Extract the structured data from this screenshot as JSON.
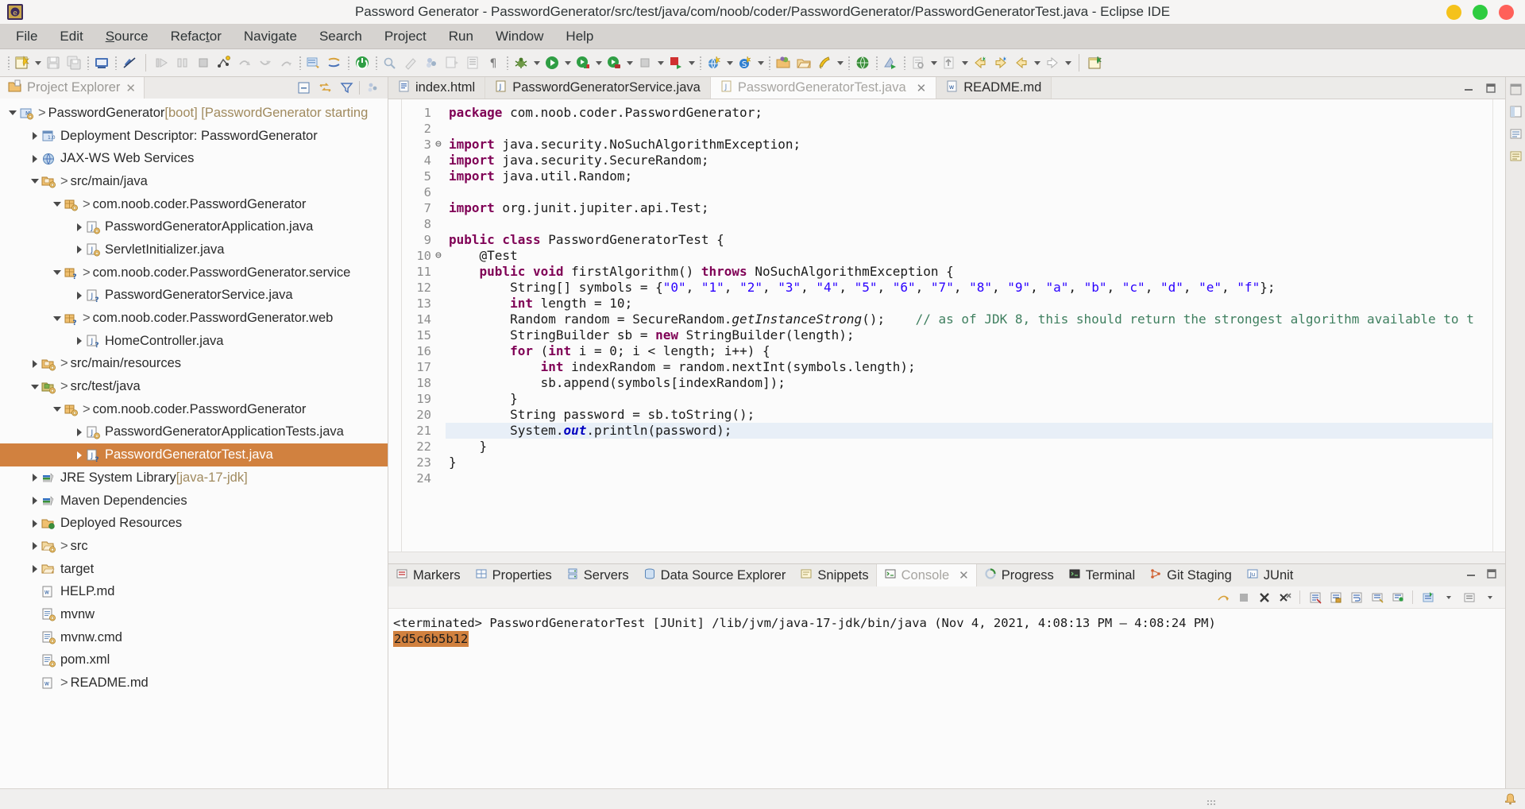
{
  "window": {
    "title": "Password Generator - PasswordGenerator/src/test/java/com/noob/coder/PasswordGenerator/PasswordGeneratorTest.java - Eclipse IDE",
    "logo_icon": "eclipse-logo-icon",
    "controls": [
      {
        "name": "minimize-button",
        "color": "#f5c21b"
      },
      {
        "name": "maximize-button",
        "color": "#2ecc40"
      },
      {
        "name": "close-button",
        "color": "#ff6059"
      }
    ]
  },
  "menubar": {
    "items": [
      {
        "label": "File",
        "mnemonic": "F"
      },
      {
        "label": "Edit",
        "mnemonic": "E"
      },
      {
        "label": "Source",
        "mnemonic": "S"
      },
      {
        "label": "Refactor",
        "mnemonic": "t"
      },
      {
        "label": "Navigate",
        "mnemonic": "N"
      },
      {
        "label": "Search",
        "mnemonic": "a"
      },
      {
        "label": "Project",
        "mnemonic": "P"
      },
      {
        "label": "Run",
        "mnemonic": "R"
      },
      {
        "label": "Window",
        "mnemonic": "W"
      },
      {
        "label": "Help",
        "mnemonic": "H"
      }
    ]
  },
  "toolbar": {
    "icons": [
      "new-wizard-icon",
      "new-dropdown-arrow",
      "save-icon",
      "save-all-icon",
      "print-icon",
      "link-broken-icon",
      "debug-run-icon",
      "pause-icon",
      "terminate-icon",
      "step-into-icon",
      "step-over-icon",
      "step-return-icon",
      "drop-to-frame-icon",
      "open-task-icon",
      "skip-breakpoints-icon",
      "power-run-server-icon",
      "new-java-project-icon",
      "new-annotation-icon",
      "new-package-icon",
      "export-icon",
      "open-type-icon",
      "show-whitespace-icon",
      "debug-bug-icon",
      "debug-dropdown-arrow",
      "run-icon",
      "run-dropdown-arrow",
      "run-coverage-icon",
      "coverage-dropdown-arrow",
      "external-tools-icon",
      "external-dropdown-arrow",
      "server-stop-icon",
      "server-stop-arrow",
      "server-start-icon",
      "server-start-arrow",
      "new-web-project-icon",
      "web-dropdown-arrow",
      "spring-boot-icon",
      "spring-dropdown-arrow",
      "open-package-icon",
      "open-folder-icon",
      "quick-launch-icon",
      "launch-dropdown-arrow",
      "web-browser-icon",
      "validate-icon",
      "search-file-icon",
      "search-dropdown-arrow",
      "annotation-prev-icon",
      "annotation-dropdown-arrow",
      "back-history-icon",
      "forward-history-icon",
      "previous-edit-icon",
      "previous-dropdown-arrow",
      "next-edit-icon",
      "next-dropdown-arrow",
      "new-editor-icon"
    ]
  },
  "explorer": {
    "tab_label": "Project Explorer",
    "tab_icon": "project-explorer-icon",
    "tab_close_icon": "close-icon",
    "tools": [
      "collapse-all-icon",
      "link-with-editor-icon",
      "view-filter-icon",
      "view-menu-icon"
    ],
    "tree": [
      {
        "indent": 0,
        "twisty": "open",
        "icon": "spring-project-icon",
        "gt": true,
        "label": "PasswordGenerator",
        "dim": " [boot] [PasswordGenerator starting"
      },
      {
        "indent": 1,
        "twisty": "closed",
        "icon": "deployment-descriptor-icon",
        "gt": false,
        "label": "Deployment Descriptor: PasswordGenerator",
        "dim": ""
      },
      {
        "indent": 1,
        "twisty": "closed",
        "icon": "jaxws-icon",
        "gt": false,
        "label": "JAX-WS Web Services",
        "dim": ""
      },
      {
        "indent": 1,
        "twisty": "open",
        "icon": "source-folder-icon",
        "gt": true,
        "label": "src/main/java",
        "dim": ""
      },
      {
        "indent": 2,
        "twisty": "open",
        "icon": "package-icon",
        "gt": true,
        "label": "com.noob.coder.PasswordGenerator",
        "dim": ""
      },
      {
        "indent": 3,
        "twisty": "closed",
        "icon": "java-file-icon",
        "gt": false,
        "label": "PasswordGeneratorApplication.java",
        "dim": ""
      },
      {
        "indent": 3,
        "twisty": "closed",
        "icon": "java-file-icon",
        "gt": false,
        "label": "ServletInitializer.java",
        "dim": ""
      },
      {
        "indent": 2,
        "twisty": "open",
        "icon": "package-untracked-icon",
        "gt": true,
        "label": "com.noob.coder.PasswordGenerator.service",
        "dim": ""
      },
      {
        "indent": 3,
        "twisty": "closed",
        "icon": "java-file-untracked-icon",
        "gt": false,
        "label": "PasswordGeneratorService.java",
        "dim": ""
      },
      {
        "indent": 2,
        "twisty": "open",
        "icon": "package-untracked-icon",
        "gt": true,
        "label": "com.noob.coder.PasswordGenerator.web",
        "dim": ""
      },
      {
        "indent": 3,
        "twisty": "closed",
        "icon": "java-file-untracked-icon",
        "gt": false,
        "label": "HomeController.java",
        "dim": ""
      },
      {
        "indent": 1,
        "twisty": "closed",
        "icon": "source-folder-icon",
        "gt": true,
        "label": "src/main/resources",
        "dim": ""
      },
      {
        "indent": 1,
        "twisty": "open",
        "icon": "test-source-folder-icon",
        "gt": true,
        "label": "src/test/java",
        "dim": ""
      },
      {
        "indent": 2,
        "twisty": "open",
        "icon": "package-icon",
        "gt": true,
        "label": "com.noob.coder.PasswordGenerator",
        "dim": ""
      },
      {
        "indent": 3,
        "twisty": "closed",
        "icon": "java-file-icon",
        "gt": false,
        "label": "PasswordGeneratorApplicationTests.java",
        "dim": ""
      },
      {
        "indent": 3,
        "twisty": "closed",
        "icon": "java-file-untracked-icon",
        "gt": false,
        "label": "PasswordGeneratorTest.java",
        "dim": "",
        "selected": true
      },
      {
        "indent": 1,
        "twisty": "closed",
        "icon": "library-icon",
        "gt": false,
        "label": "JRE System Library ",
        "dim": "[java-17-jdk]"
      },
      {
        "indent": 1,
        "twisty": "closed",
        "icon": "library-icon",
        "gt": false,
        "label": "Maven Dependencies",
        "dim": ""
      },
      {
        "indent": 1,
        "twisty": "closed",
        "icon": "deployed-resources-icon",
        "gt": false,
        "label": "Deployed Resources",
        "dim": ""
      },
      {
        "indent": 1,
        "twisty": "closed",
        "icon": "folder-icon",
        "gt": true,
        "label": "src",
        "dim": ""
      },
      {
        "indent": 1,
        "twisty": "closed",
        "icon": "folder-plain-icon",
        "gt": false,
        "label": "target",
        "dim": ""
      },
      {
        "indent": 1,
        "twisty": "none",
        "icon": "markdown-file-icon",
        "gt": false,
        "label": "HELP.md",
        "dim": ""
      },
      {
        "indent": 1,
        "twisty": "none",
        "icon": "text-file-icon",
        "gt": false,
        "label": "mvnw",
        "dim": ""
      },
      {
        "indent": 1,
        "twisty": "none",
        "icon": "text-file-icon",
        "gt": false,
        "label": "mvnw.cmd",
        "dim": ""
      },
      {
        "indent": 1,
        "twisty": "none",
        "icon": "xml-file-icon",
        "gt": false,
        "label": "pom.xml",
        "dim": ""
      },
      {
        "indent": 1,
        "twisty": "none",
        "icon": "markdown-file-icon",
        "gt": true,
        "label": "README.md",
        "dim": ""
      }
    ]
  },
  "editor": {
    "tabs": [
      {
        "label": "index.html",
        "icon": "html-file-icon",
        "active": false,
        "closable": false
      },
      {
        "label": "PasswordGeneratorService.java",
        "icon": "java-file-icon",
        "active": false,
        "closable": false
      },
      {
        "label": "PasswordGeneratorTest.java",
        "icon": "java-file-icon",
        "active": true,
        "closable": true,
        "close_icon": "close-icon"
      },
      {
        "label": "README.md",
        "icon": "markdown-file-icon",
        "active": false,
        "closable": false
      }
    ],
    "minimize_icon": "minimize-icon",
    "maximize_icon": "maximize-icon",
    "highlighted_line": 21,
    "lines": [
      {
        "n": 1,
        "fold": "",
        "html": "<span class=\"kw\">package</span> com.noob.coder.PasswordGenerator;"
      },
      {
        "n": 2,
        "fold": "",
        "html": ""
      },
      {
        "n": 3,
        "fold": "⊖",
        "html": "<span class=\"kw\">import</span> java.security.NoSuchAlgorithmException;"
      },
      {
        "n": 4,
        "fold": "",
        "html": "<span class=\"kw\">import</span> java.security.SecureRandom;"
      },
      {
        "n": 5,
        "fold": "",
        "html": "<span class=\"kw\">import</span> java.util.Random;"
      },
      {
        "n": 6,
        "fold": "",
        "html": ""
      },
      {
        "n": 7,
        "fold": "",
        "html": "<span class=\"kw\">import</span> org.junit.jupiter.api.Test;"
      },
      {
        "n": 8,
        "fold": "",
        "html": ""
      },
      {
        "n": 9,
        "fold": "",
        "html": "<span class=\"kw\">public class</span> PasswordGeneratorTest {"
      },
      {
        "n": 10,
        "fold": "⊖",
        "html": "    @Test"
      },
      {
        "n": 11,
        "fold": "",
        "html": "    <span class=\"kw\">public void</span> firstAlgorithm() <span class=\"kw\">throws</span> NoSuchAlgorithmException {"
      },
      {
        "n": 12,
        "fold": "",
        "html": "        String[] symbols = {<span class=\"str\">\"0\"</span>, <span class=\"str\">\"1\"</span>, <span class=\"str\">\"2\"</span>, <span class=\"str\">\"3\"</span>, <span class=\"str\">\"4\"</span>, <span class=\"str\">\"5\"</span>, <span class=\"str\">\"6\"</span>, <span class=\"str\">\"7\"</span>, <span class=\"str\">\"8\"</span>, <span class=\"str\">\"9\"</span>, <span class=\"str\">\"a\"</span>, <span class=\"str\">\"b\"</span>, <span class=\"str\">\"c\"</span>, <span class=\"str\">\"d\"</span>, <span class=\"str\">\"e\"</span>, <span class=\"str\">\"f\"</span>};"
      },
      {
        "n": 13,
        "fold": "",
        "html": "        <span class=\"kw\">int</span> length = 10;"
      },
      {
        "n": 14,
        "fold": "",
        "html": "        Random random = SecureRandom.<span class=\"smeth\">getInstanceStrong</span>();    <span class=\"cmt\">// as of JDK 8, this should return the strongest algorithm available to t</span>"
      },
      {
        "n": 15,
        "fold": "",
        "html": "        StringBuilder sb = <span class=\"kw\">new</span> StringBuilder(length);"
      },
      {
        "n": 16,
        "fold": "",
        "html": "        <span class=\"kw\">for</span> (<span class=\"kw\">int</span> i = 0; i &lt; length; i++) {"
      },
      {
        "n": 17,
        "fold": "",
        "html": "            <span class=\"kw\">int</span> indexRandom = random.nextInt(symbols.length);"
      },
      {
        "n": 18,
        "fold": "",
        "html": "            sb.append(symbols[indexRandom]);"
      },
      {
        "n": 19,
        "fold": "",
        "html": "        }"
      },
      {
        "n": 20,
        "fold": "",
        "html": "        String password = sb.toString();"
      },
      {
        "n": 21,
        "fold": "",
        "html": "        System.<span class=\"sfield\">out</span>.println(password);"
      },
      {
        "n": 22,
        "fold": "",
        "html": "    }"
      },
      {
        "n": 23,
        "fold": "",
        "html": "}"
      },
      {
        "n": 24,
        "fold": "",
        "html": ""
      }
    ]
  },
  "console": {
    "tabs": [
      {
        "label": "Markers",
        "icon": "markers-icon",
        "active": false
      },
      {
        "label": "Properties",
        "icon": "properties-icon",
        "active": false
      },
      {
        "label": "Servers",
        "icon": "servers-icon",
        "active": false
      },
      {
        "label": "Data Source Explorer",
        "icon": "data-source-explorer-icon",
        "active": false
      },
      {
        "label": "Snippets",
        "icon": "snippets-icon",
        "active": false
      },
      {
        "label": "Console",
        "icon": "console-icon",
        "active": true,
        "close_icon": "close-icon"
      },
      {
        "label": "Progress",
        "icon": "progress-icon",
        "active": false
      },
      {
        "label": "Terminal",
        "icon": "terminal-icon",
        "active": false
      },
      {
        "label": "Git Staging",
        "icon": "git-staging-icon",
        "active": false
      },
      {
        "label": "JUnit",
        "icon": "junit-icon",
        "active": false
      }
    ],
    "minimize_icon": "minimize-icon",
    "maximize_icon": "maximize-icon",
    "tools": [
      "terminate-all-icon",
      "terminate-icon",
      "remove-launch-icon",
      "remove-all-terminated-icon",
      "clear-console-icon",
      "scroll-lock-icon",
      "word-wrap-icon",
      "pin-console-icon",
      "display-console-icon",
      "open-console-icon",
      "open-console-arrow",
      "view-menu-icon",
      "view-menu-arrow"
    ],
    "status_line": "<terminated> PasswordGeneratorTest [JUnit] /lib/jvm/java-17-jdk/bin/java (Nov 4, 2021, 4:08:13 PM – 4:08:24 PM)",
    "output": "2d5c6b5b12",
    "output_highlight_color": "#d1813f"
  },
  "rail": {
    "icons": [
      "restore-perspective-icon",
      "java-perspective-icon",
      "outline-view-icon",
      "task-list-icon"
    ]
  },
  "statusbar": {
    "resize_grip_icon": "resize-grip-icon",
    "right_icons": [
      "notification-icon"
    ]
  }
}
